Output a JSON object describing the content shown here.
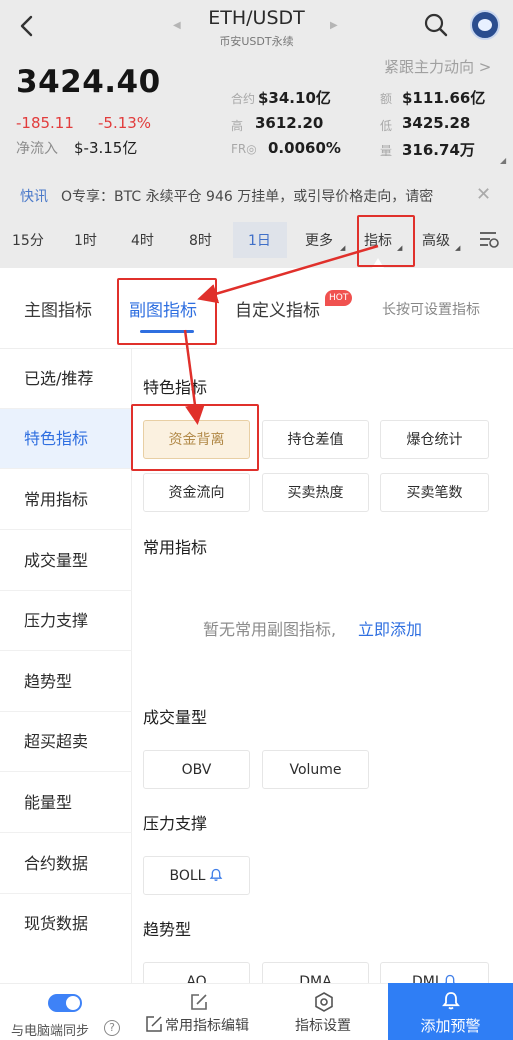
{
  "header": {
    "pair": "ETH/USDT",
    "subtitle": "币安USDT永续",
    "follow_link": "紧跟主力动向 >"
  },
  "ticker": {
    "price": "3424.40",
    "change_abs": "-185.11",
    "change_pct": "-5.13%",
    "inflow_label": "净流入",
    "inflow_value": "$-3.15亿",
    "stats": [
      {
        "label": "合约",
        "value": "$34.10亿"
      },
      {
        "label": "额",
        "value": "$111.66亿"
      },
      {
        "label": "高",
        "value": "3612.20"
      },
      {
        "label": "低",
        "value": "3425.28"
      },
      {
        "label": "FR◎",
        "value": "0.0060%"
      },
      {
        "label": "量",
        "value": "316.74万"
      }
    ]
  },
  "news": {
    "tag": "快讯",
    "text": "O专享：BTC 永续平仓 946 万挂单，或引导价格走向，请密"
  },
  "intervals": {
    "i15m": "15分",
    "i1h": "1时",
    "i4h": "4时",
    "i8h": "8时",
    "i1d": "1日",
    "more": "更多",
    "indicators": "指标",
    "advanced": "高级"
  },
  "panel": {
    "tabs": {
      "main": "主图指标",
      "sub": "副图指标",
      "custom": "自定义指标"
    },
    "hot": "HOT",
    "hint": "长按可设置指标",
    "sidebar": [
      "已选/推荐",
      "特色指标",
      "常用指标",
      "成交量型",
      "压力支撑",
      "趋势型",
      "超买超卖",
      "能量型",
      "合约数据",
      "现货数据"
    ],
    "featured": {
      "title": "特色指标",
      "chips": [
        "资金背离",
        "持仓差值",
        "爆仓统计",
        "资金流向",
        "买卖热度",
        "买卖笔数"
      ]
    },
    "common": {
      "title": "常用指标",
      "empty": "暂无常用副图指标,",
      "add_link": "立即添加"
    },
    "volume": {
      "title": "成交量型",
      "chips": [
        "OBV",
        "Volume"
      ]
    },
    "support": {
      "title": "压力支撑",
      "chips": [
        "BOLL"
      ]
    },
    "trend": {
      "title": "趋势型",
      "chips": [
        "AO",
        "DMA",
        "DMI"
      ]
    }
  },
  "bottom": {
    "sync": "与电脑端同步",
    "help": "?",
    "edit": "常用指标编辑",
    "settings": "指标设置",
    "alert": "添加预警"
  },
  "colors": {
    "accent": "#2f6fe0",
    "down": "#e23c3c",
    "annotation": "#e0302b",
    "selected_chip_bg": "#fbf1e0"
  }
}
